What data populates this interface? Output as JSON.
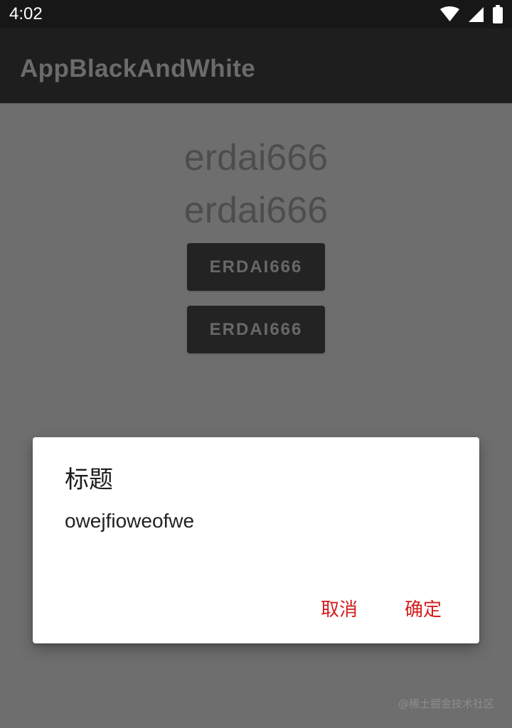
{
  "status_bar": {
    "time": "4:02",
    "icons": [
      "wifi-icon",
      "cellular-icon",
      "battery-icon"
    ]
  },
  "app_bar": {
    "title": "AppBlackAndWhite"
  },
  "main": {
    "text_lines": [
      "erdai666",
      "erdai666"
    ],
    "buttons": [
      "ERDAI666",
      "ERDAI666"
    ]
  },
  "dialog": {
    "title": "标题",
    "message": "owejfioweofwe",
    "cancel_label": "取消",
    "confirm_label": "确定"
  },
  "watermark": {
    "text": "@稀土掘金技术社区"
  },
  "colors": {
    "status_bar": "#171717",
    "app_bar": "#1E1E1E",
    "scrim": "#6E6E6E",
    "dialog_action": "#D21D1D"
  }
}
